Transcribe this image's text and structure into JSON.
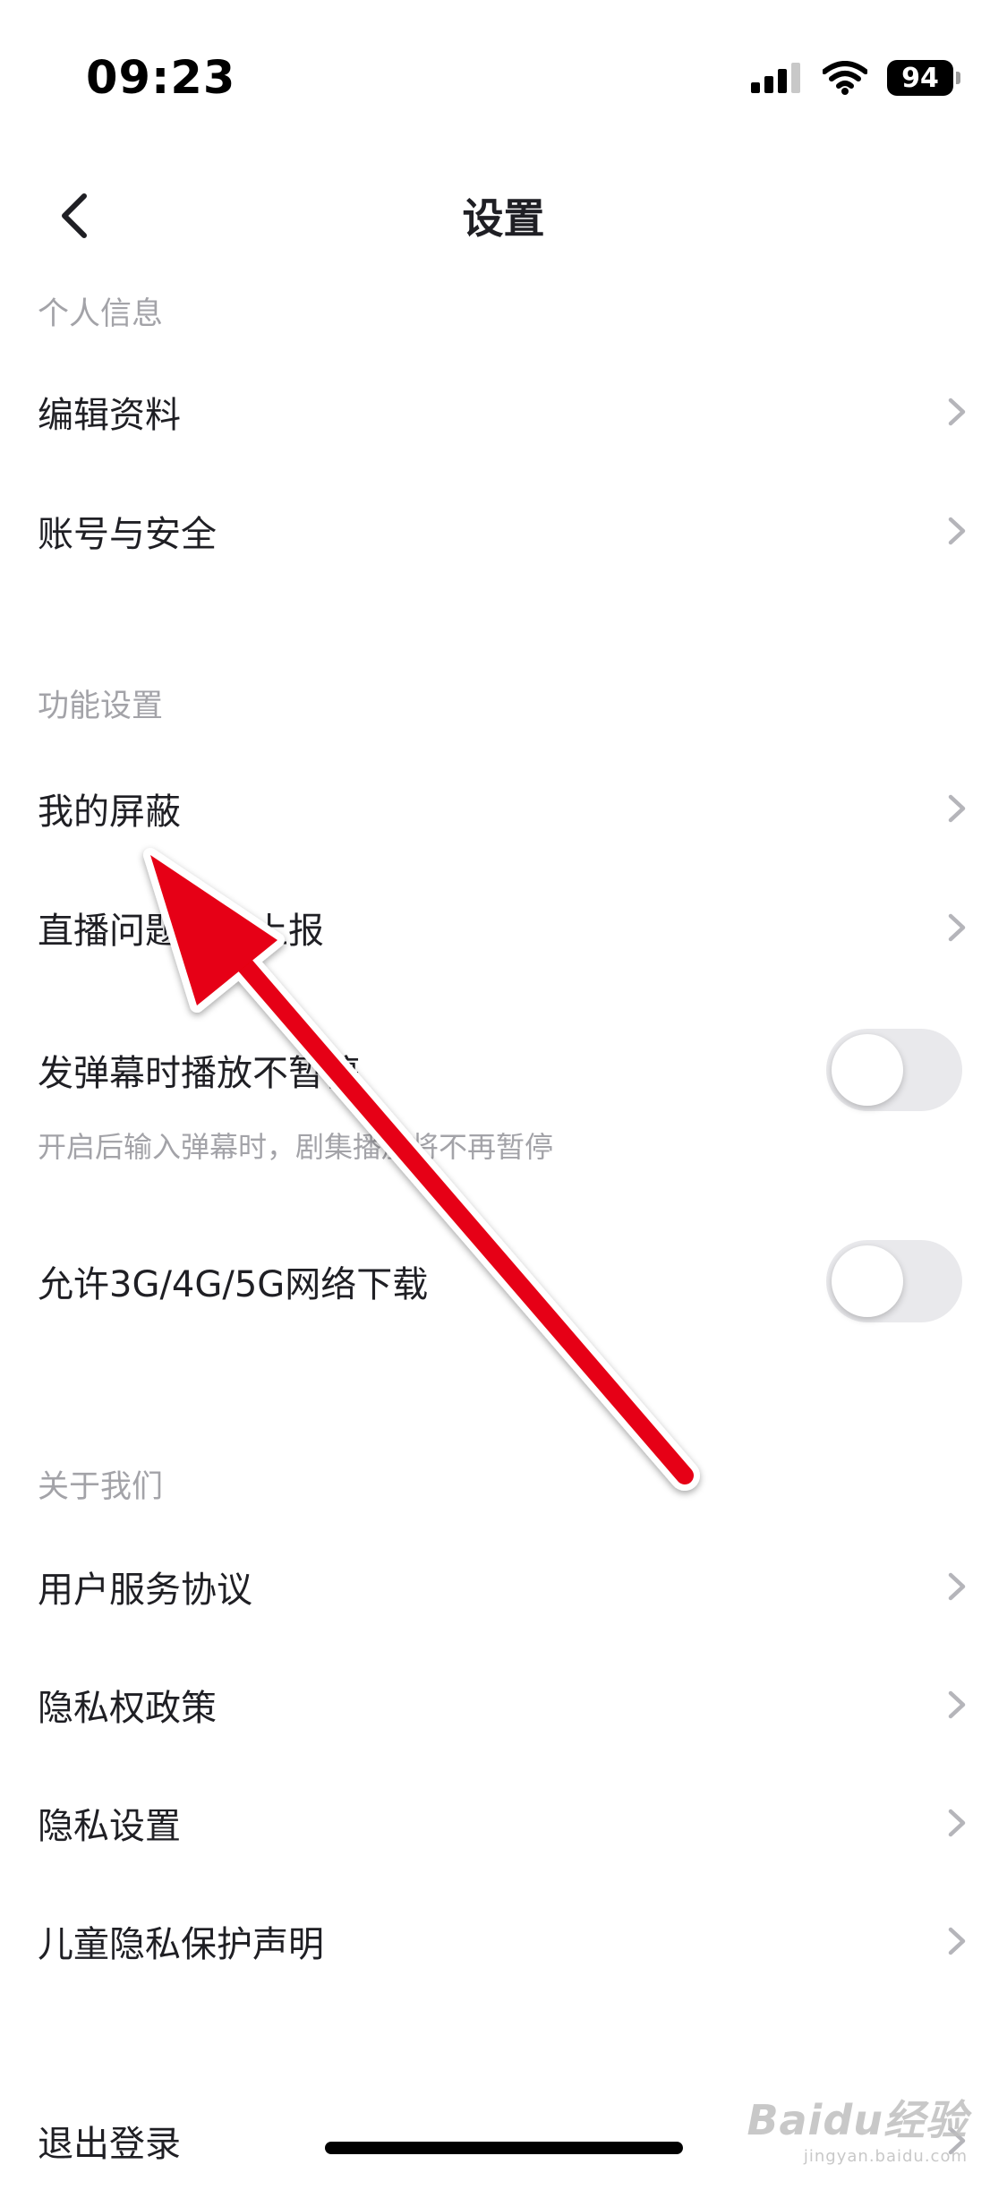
{
  "status_bar": {
    "time": "09:23",
    "battery": "94",
    "icons": [
      "cellular-signal-icon",
      "wifi-icon",
      "battery-icon"
    ]
  },
  "nav": {
    "title": "设置",
    "back_icon": "chevron-left-icon"
  },
  "sections": {
    "personal": {
      "header": "个人信息",
      "items": [
        {
          "label": "编辑资料"
        },
        {
          "label": "账号与安全"
        }
      ]
    },
    "features": {
      "header": "功能设置",
      "items": [
        {
          "label": "我的屏蔽"
        },
        {
          "label": "直播问题反馈上报"
        }
      ],
      "toggles": [
        {
          "label": "发弹幕时播放不暂停",
          "subtitle": "开启后输入弹幕时，剧集播放将不再暂停",
          "on": false
        },
        {
          "label": "允许3G/4G/5G网络下载",
          "on": false
        }
      ]
    },
    "about": {
      "header": "关于我们",
      "items": [
        {
          "label": "用户服务协议"
        },
        {
          "label": "隐私权政策"
        },
        {
          "label": "隐私设置"
        },
        {
          "label": "儿童隐私保护声明"
        }
      ]
    }
  },
  "logout": {
    "label": "退出登录"
  },
  "watermark": {
    "main": "Baidu经验",
    "sub": "jingyan.baidu.com"
  },
  "colors": {
    "text_primary": "#1f1f24",
    "text_secondary": "#a3a3a8",
    "chevron": "#b5b5ba",
    "toggle_off": "#e9e9ec",
    "annotation_arrow": "#e60012"
  }
}
